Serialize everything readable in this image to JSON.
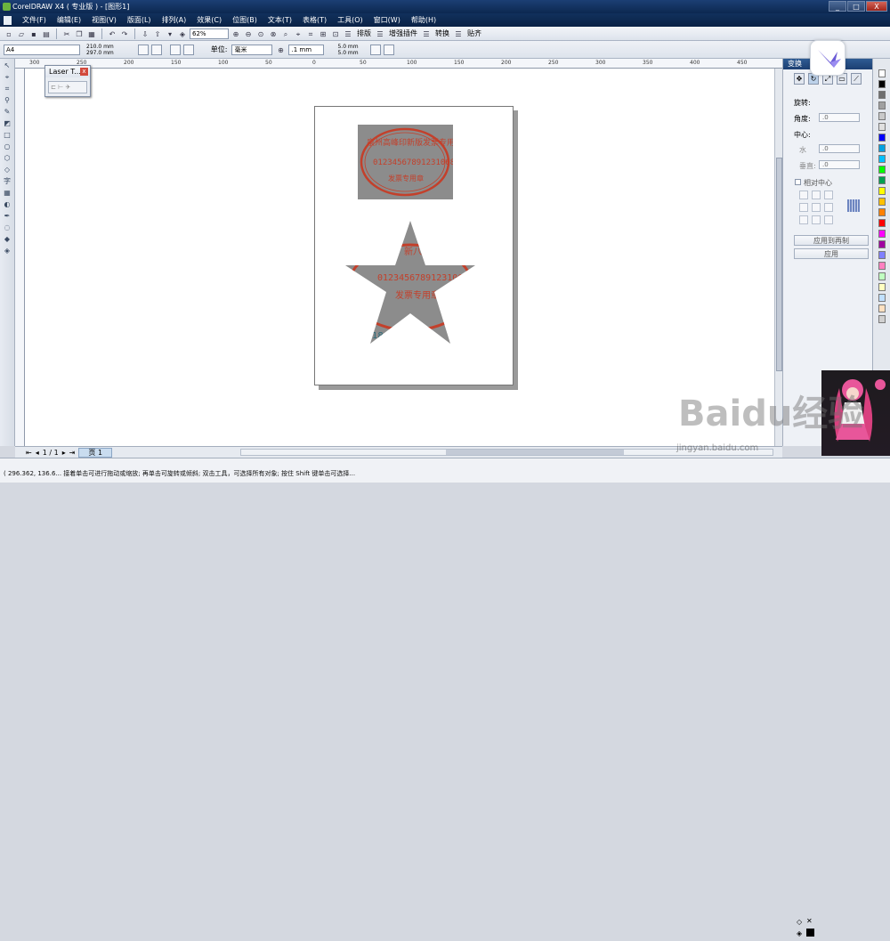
{
  "window": {
    "title": "CorelDRAW X4 ( 专业版 ) - [图形1]",
    "controls": [
      "_",
      "□",
      "X"
    ]
  },
  "menu": [
    "文件(F)",
    "编辑(E)",
    "视图(V)",
    "版面(L)",
    "排列(A)",
    "效果(C)",
    "位图(B)",
    "文本(T)",
    "表格(T)",
    "工具(O)",
    "窗口(W)",
    "帮助(H)"
  ],
  "toolbar1": {
    "zoom": "62%",
    "layout_label": "排版",
    "plugin_label": "增强插件",
    "convert_label": "转换",
    "paste_label": "贴齐"
  },
  "toolbar2": {
    "page_size": "A4",
    "width": "210.0 mm",
    "height": "297.0 mm",
    "unit_label": "单位:",
    "unit": "毫米",
    "nudge": ".1 mm",
    "dup_x": "5.0 mm",
    "dup_y": "5.0 mm"
  },
  "ruler_ticks": [
    "300",
    "250",
    "200",
    "150",
    "100",
    "50",
    "0",
    "50",
    "100",
    "150",
    "200",
    "250",
    "300",
    "350",
    "400",
    "450"
  ],
  "laser_panel": {
    "title": "Laser T..."
  },
  "docker": {
    "title": "变换",
    "rotation_label": "旋转:",
    "angle_label": "角度:",
    "angle_value": ".0",
    "center_label": "中心:",
    "h_label": "水",
    "h_value": ".0",
    "v_label": "垂直:",
    "v_value": ".0",
    "relative_center": "相对中心",
    "apply_dup": "应用到再制",
    "apply": "应用"
  },
  "stamp": {
    "top_text": "泉州高峰印新版发票专用章",
    "number": "012345678912310689",
    "bottom_text": "发票专用章",
    "star_top": "新八",
    "star_number": "012345678912310689",
    "star_bottom": "发票专用章",
    "star_prefix": "18"
  },
  "bottom_nav": {
    "page_counter": "1 / 1",
    "page_tab": "页 1"
  },
  "status": {
    "text": "( 296.362, 136.6... 接着单击可进行拖动或缩放; 再单击可旋转或倾斜; 双击工具，可选择所有对象; 按住 Shift 键单击可选择..."
  },
  "watermark": {
    "brand": "Baidu经验",
    "url": "jingyan.baidu.com"
  },
  "colors": {
    "title_bar": "#0c2850",
    "stamp_red": "#c3402b",
    "stamp_gray": "#8c8c8c",
    "docker_header": "#1c3f72"
  },
  "palette": [
    "#ffffff",
    "#000000",
    "#6f6f6f",
    "#a0a0a0",
    "#c9c9c9",
    "#e0e0e0",
    "#0000ff",
    "#00a0e0",
    "#00c0ff",
    "#00ff00",
    "#00a050",
    "#ffff00",
    "#ffc000",
    "#ff8000",
    "#ff0000",
    "#ff00ff",
    "#a000a0",
    "#8080ff",
    "#ff80c0",
    "#c0ffc0",
    "#ffffc0",
    "#c0e0ff",
    "#ffe0c0",
    "#d0d0d0"
  ]
}
